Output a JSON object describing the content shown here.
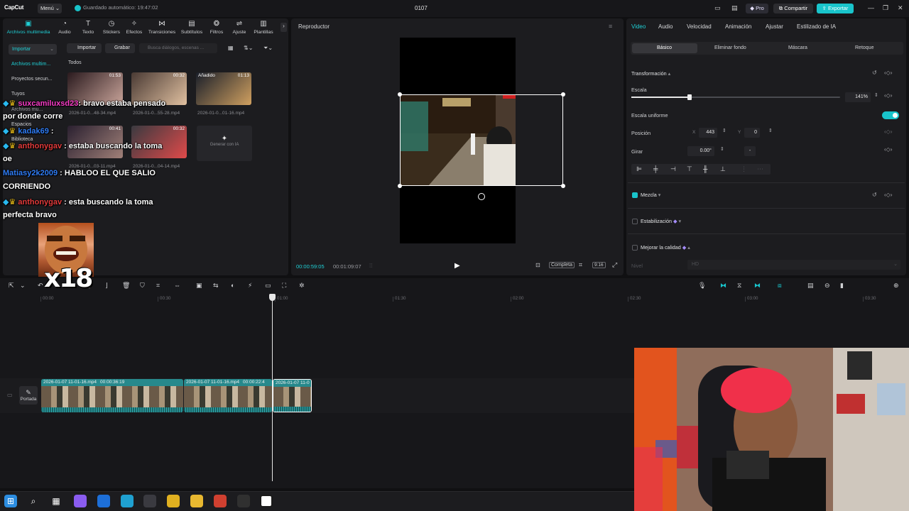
{
  "app": {
    "logo": "CapCut",
    "menu_label": "Menú",
    "autosave": "Guardado automático: 19:47:02",
    "project_name": "0107",
    "pro_label": "Pro",
    "share_label": "Compartir",
    "export_label": "Exportar"
  },
  "toolbar": {
    "tabs": [
      {
        "label": "Archivos multimedia",
        "icon": "media-icon"
      },
      {
        "label": "Audio",
        "icon": "audio-icon"
      },
      {
        "label": "Texto",
        "icon": "text-icon"
      },
      {
        "label": "Stickers",
        "icon": "sticker-icon"
      },
      {
        "label": "Efectos",
        "icon": "effects-icon"
      },
      {
        "label": "Transiciones",
        "icon": "transition-icon"
      },
      {
        "label": "Subtítulos",
        "icon": "subtitle-icon"
      },
      {
        "label": "Filtros",
        "icon": "filter-icon"
      },
      {
        "label": "Ajuste",
        "icon": "adjust-icon"
      },
      {
        "label": "Plantillas",
        "icon": "template-icon"
      }
    ]
  },
  "media": {
    "sidebar": {
      "import": "Importar",
      "items": [
        "Archivos multim...",
        "Proyectos secun...",
        "Tuyos",
        "Archivos mu...",
        "Espacios",
        "Biblioteca"
      ]
    },
    "import_btn": "Importar",
    "record_btn": "Grabar",
    "search_placeholder": "Busca diálogos, escenas ...",
    "filter_all": "Todos",
    "thumbs": [
      {
        "duration": "01:53",
        "caption": "2026-01-0...48-34.mp4",
        "badge": ""
      },
      {
        "duration": "00:32",
        "caption": "2026-01-0...55-28.mp4",
        "badge": ""
      },
      {
        "duration": "01:13",
        "caption": "2026-01-0...01-16.mp4",
        "badge": "Añadido"
      },
      {
        "duration": "00:41",
        "caption": "2026-01-0...03-11.mp4",
        "badge": ""
      },
      {
        "duration": "00:32",
        "caption": "2026-01-0...04-14.mp4",
        "badge": ""
      }
    ],
    "generate_ai": "Generar con IA"
  },
  "player": {
    "title": "Reproductor",
    "time_current": "00:00:59:05",
    "time_total": "00:01:09:07",
    "full_label": "Completa",
    "ratio_label": "9:16"
  },
  "inspector": {
    "tabs": [
      "Video",
      "Audio",
      "Velocidad",
      "Animación",
      "Ajustar",
      "Estilizado de IA"
    ],
    "subtabs": [
      "Básico",
      "Eliminar fondo",
      "Máscara",
      "Retoque"
    ],
    "transform_title": "Transformación",
    "scale_label": "Escala",
    "scale_value": "141%",
    "scale_fraction": 0.28,
    "uniform_label": "Escala uniforme",
    "position_label": "Posición",
    "pos_x_label": "X",
    "pos_x": "443",
    "pos_y_label": "Y",
    "pos_y": "0",
    "rotate_label": "Girar",
    "rotate_value": "0.00°",
    "rotate_dash": "-",
    "blend_label": "Mezcla",
    "stabilize_label": "Estabilización",
    "enhance_label": "Mejorar la calidad",
    "level_label": "Nivel",
    "level_value": "HD"
  },
  "timeline": {
    "ticks": [
      "00:00",
      "00:30",
      "01:00",
      "01:30",
      "02:00",
      "02:30",
      "03:00",
      "03:30"
    ],
    "cover_label": "Portada",
    "clips": [
      {
        "name": "2026-01-07 11-01-16.mp4",
        "duration": "00:00:36:19"
      },
      {
        "name": "2026-01-07 11-01-16.mp4",
        "duration": "00:00:22:4"
      },
      {
        "name": "2026-01-07 11-0",
        "duration": ""
      }
    ]
  },
  "chat": [
    {
      "user": "suxcamiluxsd23",
      "text": ": bravo estaba pensado",
      "cont": "por donde corre"
    },
    {
      "user": "kadak69",
      "text": " :",
      "cont": ""
    },
    {
      "user": "anthonygav",
      "text": " : estaba buscando la toma",
      "cont": "oe"
    },
    {
      "user": "Matiasy2k2009",
      "text": " : HABLOO EL QUE SALIO",
      "cont": "CORRIENDO"
    },
    {
      "user": "anthonygav",
      "text": " : esta buscando la toma",
      "cont": "perfecta bravo"
    }
  ],
  "emote_text": "x18",
  "colors": {
    "accent": "#19c4cb",
    "panel": "#1c1c1f",
    "clip": "#1e6f72"
  }
}
